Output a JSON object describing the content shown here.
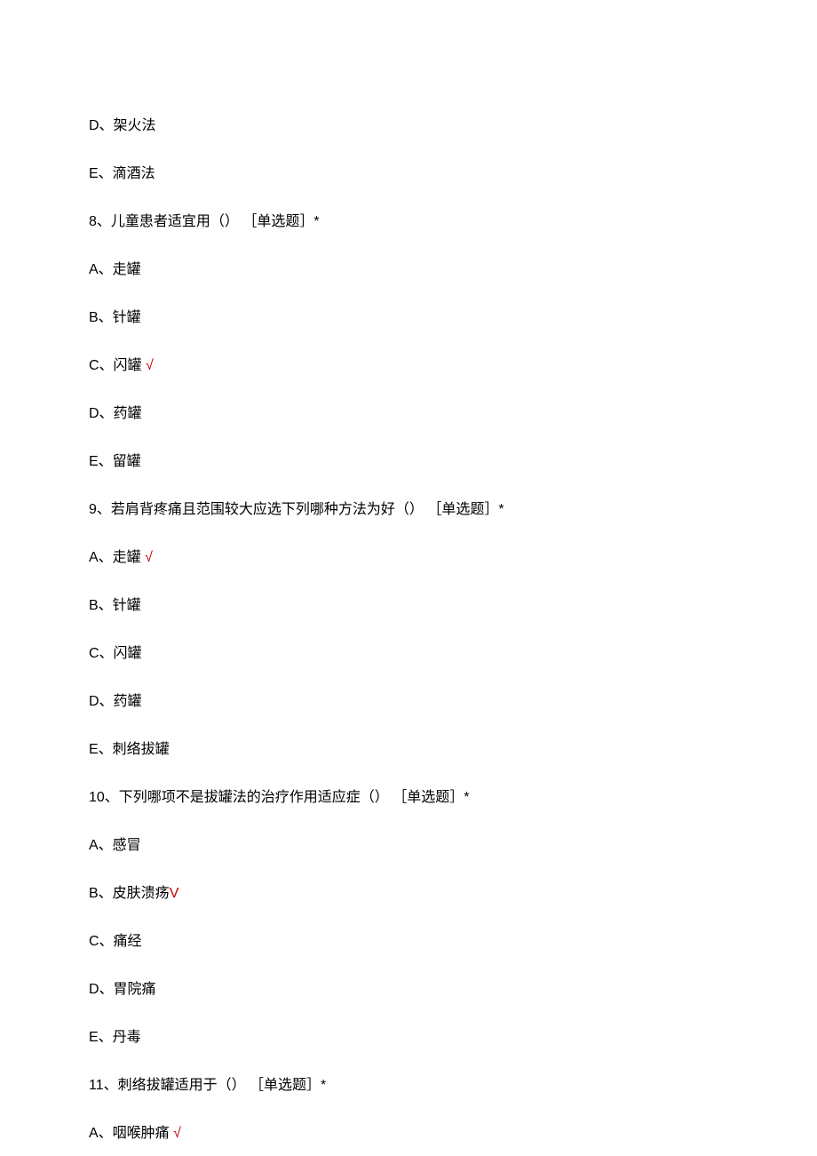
{
  "lines": {
    "prev_d": "D、架火法",
    "prev_e": "E、滴酒法",
    "q8_stem": "8、儿童患者适宜用（） ［单选题］*",
    "q8_a": "A、走罐",
    "q8_b": "B、针罐",
    "q8_c_text": "C、闪罐 ",
    "q8_c_check": "√",
    "q8_d": "D、药罐",
    "q8_e": "E、留罐",
    "q9_stem": "9、若肩背疼痛且范围较大应选下列哪种方法为好（） ［单选题］*",
    "q9_a_text": "A、走罐 ",
    "q9_a_check": "√",
    "q9_b": "B、针罐",
    "q9_c": "C、闪罐",
    "q9_d": "D、药罐",
    "q9_e": "E、刺络拔罐",
    "q10_stem": "10、下列哪项不是拔罐法的治疗作用适应症（） ［单选题］*",
    "q10_a": "A、感冒",
    "q10_b_text": "B、皮肤溃疡",
    "q10_b_check": "V",
    "q10_c": "C、痛经",
    "q10_d": "D、胃院痛",
    "q10_e": "E、丹毒",
    "q11_stem": "11、刺络拔罐适用于（） ［单选题］*",
    "q11_a_text": "A、咽喉肿痛 ",
    "q11_a_check": "√"
  }
}
